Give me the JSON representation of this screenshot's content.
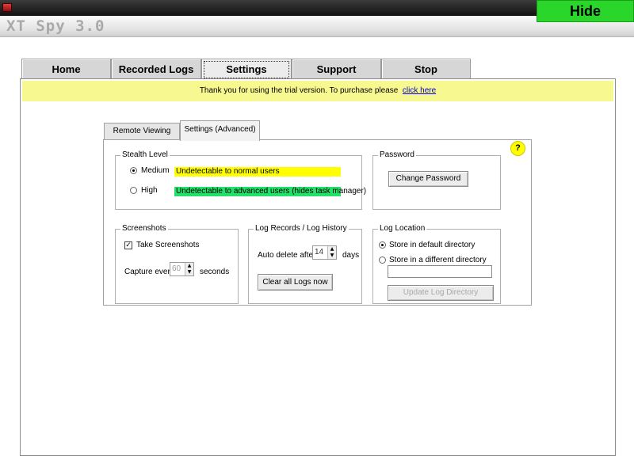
{
  "window": {
    "title": "XT Spy 3.0",
    "hide_label": "Hide",
    "controls": {
      "minimize": "_",
      "maximize": "▫",
      "close": "✕"
    }
  },
  "main_tabs": [
    {
      "label": "Home"
    },
    {
      "label": "Recorded Logs"
    },
    {
      "label": "Settings",
      "active": true
    },
    {
      "label": "Support"
    },
    {
      "label": "Stop"
    }
  ],
  "banner": {
    "text": "Thank you for using the trial version. To purchase please",
    "link": "click here"
  },
  "sub_tabs": [
    {
      "label": "Remote Viewing"
    },
    {
      "label": "Settings (Advanced)",
      "active": true
    }
  ],
  "help_label": "?",
  "stealth": {
    "legend": "Stealth Level",
    "selected": "Medium",
    "options": [
      {
        "label": "Medium",
        "description": "Undetectable to normal users",
        "color": "#ffff00"
      },
      {
        "label": "High",
        "description": "Undetectable to advanced users  (hides task manager)",
        "color": "#22e06a"
      }
    ]
  },
  "password": {
    "legend": "Password",
    "button": "Change Password"
  },
  "screenshots": {
    "legend": "Screenshots",
    "checkbox_label": "Take Screenshots",
    "checked": true,
    "capture_label": "Capture every",
    "capture_value": "60",
    "unit": "seconds"
  },
  "log_records": {
    "legend": "Log Records / Log History",
    "auto_delete_label": "Auto delete after",
    "days_value": "14",
    "unit": "days",
    "clear_button": "Clear all Logs now"
  },
  "log_location": {
    "legend": "Log Location",
    "selected": "default",
    "option_default": "Store in default directory",
    "option_different": "Store in a different directory",
    "directory_value": "",
    "update_button": "Update Log Directory"
  },
  "colors": {
    "hide_button": "#2bd62b",
    "banner": "#f8f890",
    "medium_highlight": "#ffff00",
    "high_highlight": "#22e06a",
    "help_icon": "#ffff00"
  }
}
